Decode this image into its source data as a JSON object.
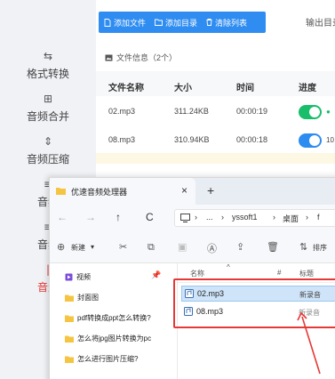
{
  "sidebar": {
    "items": [
      {
        "label": "格式转换",
        "icon": "format-convert-icon",
        "glyph": "⇆"
      },
      {
        "label": "音频合并",
        "icon": "merge-icon",
        "glyph": "⊞"
      },
      {
        "label": "音频压缩",
        "icon": "compress-icon",
        "glyph": "⇕"
      },
      {
        "label": "音频",
        "icon": "audio-icon",
        "glyph": "≡"
      },
      {
        "label": "音频",
        "icon": "audio-icon-2",
        "glyph": "≡"
      },
      {
        "label": "音量",
        "icon": "volume-icon",
        "glyph": "|"
      }
    ]
  },
  "toolbar": {
    "add_file": "添加文件",
    "add_folder": "添加目录",
    "clear_list": "清除列表",
    "output_dir": "输出目录"
  },
  "file_info": "文件信息（2个）",
  "table": {
    "headers": [
      "文件名称",
      "大小",
      "时间",
      "进度"
    ],
    "rows": [
      {
        "name": "02.mp3",
        "size": "311.24KB",
        "time": "00:00:19",
        "toggle_color": "#19be6b",
        "extra": "●"
      },
      {
        "name": "08.mp3",
        "size": "310.94KB",
        "time": "00:00:18",
        "toggle_color": "#2d8cf0",
        "extra": "10"
      }
    ]
  },
  "explorer": {
    "tab_title": "优速音频处理器",
    "close": "×",
    "new_tab": "+",
    "nav": {
      "back": "←",
      "forward": "→",
      "up": "↑",
      "refresh": "C"
    },
    "address": {
      "seg1": "...",
      "seg2": "yssoft1",
      "seg3": "桌面",
      "seg4": "f"
    },
    "toolbar": {
      "new_label": "新建",
      "sort_label": "排序"
    },
    "nav_pane": [
      "视频",
      "封面图",
      "pdf转换成ppt怎么转换?",
      "怎么将jpg图片转换为pc",
      "怎么进行图片压缩?"
    ],
    "file_headers": {
      "name": "名称",
      "num": "#",
      "title": "标题"
    },
    "files": [
      {
        "name": "02.mp3",
        "title": "新录音",
        "selected": true
      },
      {
        "name": "08.mp3",
        "title": "新录音",
        "selected": false
      }
    ]
  },
  "colors": {
    "accent": "#2f8cf0",
    "highlight": "#e53935",
    "green": "#19be6b"
  }
}
